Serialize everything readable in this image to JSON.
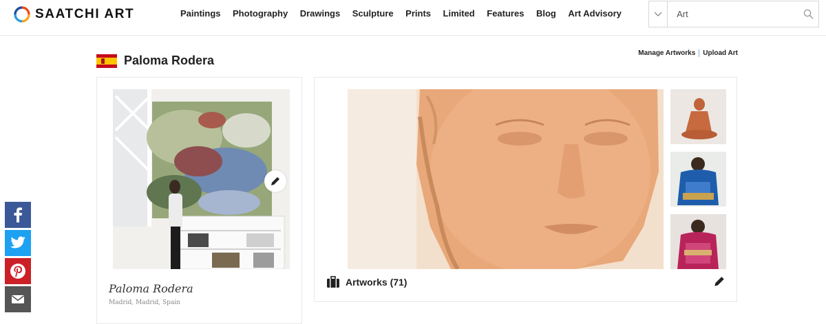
{
  "header": {
    "logo_text": "SAATCHI ART",
    "nav": [
      "Paintings",
      "Photography",
      "Drawings",
      "Sculpture",
      "Prints",
      "Limited",
      "Features",
      "Blog",
      "Art Advisory"
    ],
    "search": {
      "value": "Art"
    }
  },
  "artist": {
    "name": "Paloma Rodera",
    "country_flag": "spain-flag",
    "location": "Madrid, Madrid, Spain"
  },
  "manage_links": {
    "manage": "Manage Artworks",
    "upload": "Upload Art"
  },
  "artworks": {
    "label": "Artworks (71)"
  },
  "social": [
    {
      "name": "facebook",
      "color": "#3b5998"
    },
    {
      "name": "twitter",
      "color": "#1da1f2"
    },
    {
      "name": "pinterest",
      "color": "#cb2027"
    },
    {
      "name": "email",
      "color": "#555555"
    }
  ],
  "colors": {
    "logo_ring": [
      "#e94e1b",
      "#f5a623",
      "#2e9cd8",
      "#1f4e9c"
    ]
  }
}
